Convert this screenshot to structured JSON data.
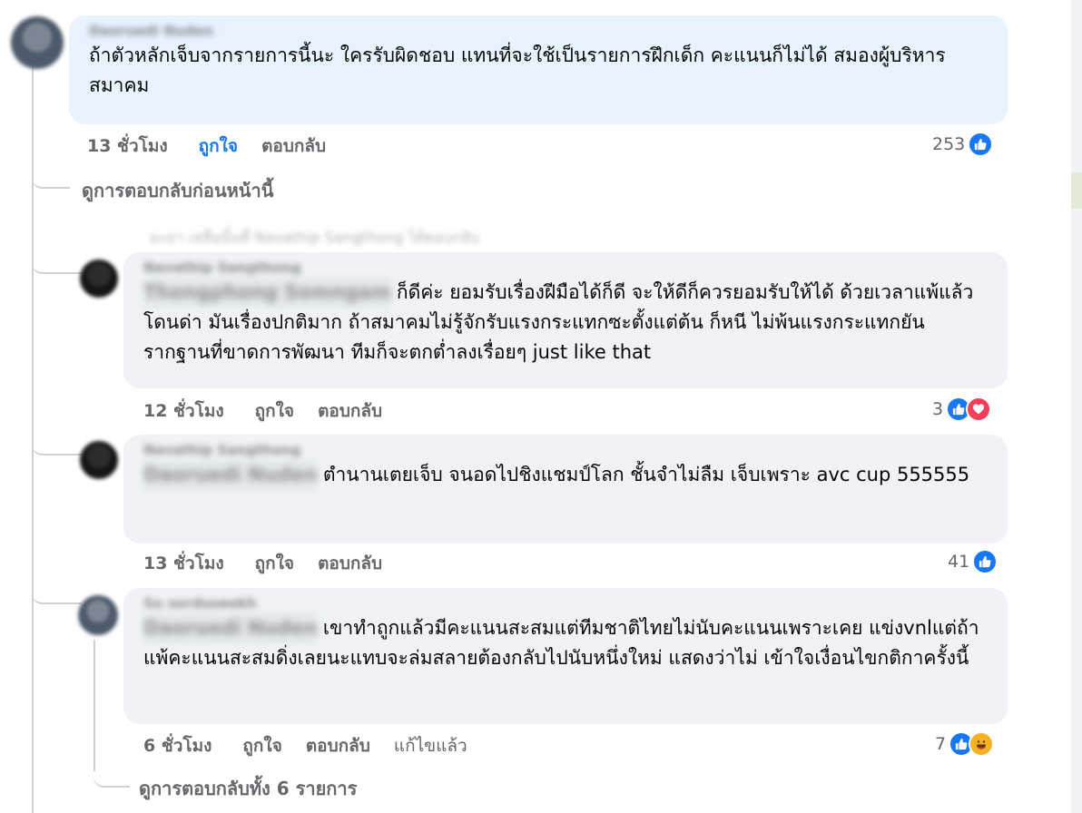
{
  "comments": [
    {
      "author": "Daoruedi Nuden",
      "text": "ถ้าตัวหลักเจ็บจากรายการนี้นะ ใครรับผิดชอบ แทนที่จะใช้เป็นรายการฝึกเด็ก คะแนนก็ไม่ได้ สมองผู้บริหารสมาคม",
      "time": "13 ชั่วโมง",
      "like_label": "ถูกใจ",
      "reply_label": "ตอบกลับ",
      "reaction_count": "253",
      "reactions": [
        "like-icon"
      ]
    },
    {
      "author": "Navathip Sangthong",
      "tag": "Thongphong Somngam",
      "text": "ก็ดีค่ะ ยอมรับเรื่องฝีมือได้ก็ดี จะให้ดีก็ควรยอมรับให้ได้ ด้วยเวลาแพ้แล้วโดนด่า มันเรื่องปกติมาก ถ้าสมาคมไม่รู้จักรับแรงกระแทกซะตั้งแต่ต้น ก็หนี ไม่พ้นแรงกระแทกยันรากฐานที่ขาดการพัฒนา ทีมก็จะตกต่ำลงเรื่อยๆ just like that",
      "time": "12 ชั่วโมง",
      "like_label": "ถูกใจ",
      "reply_label": "ตอบกลับ",
      "reaction_count": "3",
      "reactions": [
        "like-icon",
        "love-icon"
      ]
    },
    {
      "author": "Navathip Sangthong",
      "tag": "Daoruedi Nuden",
      "text": "ตำนานเตยเจ็บ จนอดไปชิงแชมป์โลก ชั้นจำไม่ลืม เจ็บเพราะ avc cup 555555",
      "time": "13 ชั่วโมง",
      "like_label": "ถูกใจ",
      "reply_label": "ตอบกลับ",
      "reaction_count": "41",
      "reactions": [
        "like-icon"
      ]
    },
    {
      "author": "Su sorduseekh",
      "tag": "Daoruedi Nuden",
      "text": "เขาทำถูกแล้วมีคะแนนสะสมแต่ทีมชาติไทยไม่นับคะแนนเพราะเคย แข่งvnlแต่ถ้าแพ้คะแนนสะสมดิ่งเลยนะแทบจะล่มสลายต้องกลับไปนับหนึ่งใหม่ แสดงว่าไม่ เข้าใจเงื่อนไขกติกาครั้งนี้",
      "time": "6 ชั่วโมง",
      "like_label": "ถูกใจ",
      "reply_label": "ตอบกลับ",
      "edited_label": "แก้ไขแล้ว",
      "reaction_count": "7",
      "reactions": [
        "like-icon",
        "haha-icon"
      ]
    }
  ],
  "view_previous_label": "ดูการตอบกลับก่อนหน้านี้",
  "replied_notice": "มะยา เหลือนั้นที่ Navathip Sangthong ได้ตอบกลับ",
  "view_all_label": "ดูการตอบกลับทั้ง 6 รายการ",
  "colors": {
    "link": "#1877f2",
    "meta": "#65676b",
    "bubble": "#f0f2f5",
    "bubble_highlight": "#e7f3ff"
  }
}
